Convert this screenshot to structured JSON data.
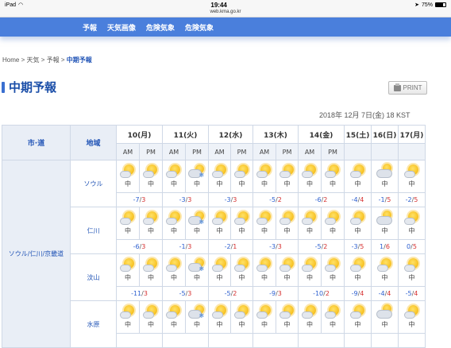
{
  "statusbar": {
    "device": "iPad",
    "time": "19:44",
    "battery": "75%"
  },
  "url": "web.kma.go.kr",
  "nav": [
    "予報",
    "天気画像",
    "危険気象",
    "危険気象"
  ],
  "breadcrumb": {
    "home": "Home",
    "sep": ">",
    "c1": "天気",
    "c2": "予報",
    "current": "中期予報"
  },
  "title": "中期予報",
  "print_label": "PRINT",
  "issued": "2018年 12月 7日(金) 18 KST",
  "table": {
    "h_region": "市·道",
    "h_area": "地域",
    "dates": [
      "10(月)",
      "11(火)",
      "12(水)",
      "13(木)",
      "14(金)",
      "15(土)",
      "16(日)",
      "17(月)"
    ],
    "am": "AM",
    "pm": "PM",
    "region": "ソウル/仁川/京畿道",
    "rows": [
      {
        "name": "ソウル",
        "icons": [
          "sun-cloud-icon",
          "sun-cloud-icon",
          "sun-cloud-icon",
          "sun-snow-icon",
          "sun-cloud-icon",
          "sun-cloud-icon",
          "sun-cloud-icon",
          "sun-cloud-icon",
          "sun-cloud-icon",
          "sun-cloud-icon",
          "sun-cloud-icon",
          "cloud-sun-icon",
          "sun-cloud-icon"
        ],
        "labels": [
          "中",
          "中",
          "中",
          "中",
          "中",
          "中",
          "中",
          "中",
          "中",
          "中",
          "中",
          "中",
          "中"
        ],
        "temps": [
          [
            "-7",
            "3"
          ],
          [
            "-3",
            "3"
          ],
          [
            "-3",
            "3"
          ],
          [
            "-5",
            "2"
          ],
          [
            "-6",
            "2"
          ],
          [
            "-4",
            "4"
          ],
          [
            "-1",
            "5"
          ],
          [
            "-2",
            "5"
          ]
        ]
      },
      {
        "name": "仁川",
        "icons": [
          "sun-cloud-icon",
          "sun-cloud-icon",
          "sun-cloud-icon",
          "sun-snow-icon",
          "sun-cloud-icon",
          "sun-cloud-icon",
          "sun-cloud-icon",
          "sun-cloud-icon",
          "sun-cloud-icon",
          "sun-cloud-icon",
          "sun-cloud-icon",
          "cloud-sun-icon",
          "sun-cloud-icon"
        ],
        "labels": [
          "中",
          "中",
          "中",
          "中",
          "中",
          "中",
          "中",
          "中",
          "中",
          "中",
          "中",
          "中",
          "中"
        ],
        "temps": [
          [
            "-6",
            "3"
          ],
          [
            "-1",
            "3"
          ],
          [
            "-2",
            "1"
          ],
          [
            "-3",
            "3"
          ],
          [
            "-5",
            "2"
          ],
          [
            "-3",
            "5"
          ],
          [
            "1",
            "6"
          ],
          [
            "0",
            "5"
          ]
        ]
      },
      {
        "name": "汶山",
        "icons": [
          "sun-cloud-icon",
          "sun-cloud-icon",
          "sun-cloud-icon",
          "sun-snow-icon",
          "sun-cloud-icon",
          "sun-cloud-icon",
          "sun-cloud-icon",
          "sun-cloud-icon",
          "sun-cloud-icon",
          "sun-cloud-icon",
          "sun-cloud-icon",
          "sun-cloud-icon",
          "sun-cloud-icon"
        ],
        "labels": [
          "中",
          "中",
          "中",
          "中",
          "中",
          "中",
          "中",
          "中",
          "中",
          "中",
          "中",
          "中",
          "中"
        ],
        "temps": [
          [
            "-11",
            "3"
          ],
          [
            "-5",
            "3"
          ],
          [
            "-5",
            "2"
          ],
          [
            "-9",
            "3"
          ],
          [
            "-10",
            "2"
          ],
          [
            "-9",
            "4"
          ],
          [
            "-4",
            "4"
          ],
          [
            "-5",
            "4"
          ]
        ]
      },
      {
        "name": "水原",
        "icons": [
          "sun-cloud-icon",
          "sun-cloud-icon",
          "sun-cloud-icon",
          "sun-snow-icon",
          "sun-cloud-icon",
          "sun-cloud-icon",
          "sun-cloud-icon",
          "sun-cloud-icon",
          "sun-cloud-icon",
          "sun-cloud-icon",
          "sun-cloud-icon",
          "cloud-sun-icon",
          "sun-cloud-icon"
        ],
        "labels": [
          "中",
          "中",
          "中",
          "中",
          "中",
          "中",
          "中",
          "中",
          "中",
          "中",
          "中",
          "中",
          "中"
        ],
        "temps": []
      }
    ]
  }
}
